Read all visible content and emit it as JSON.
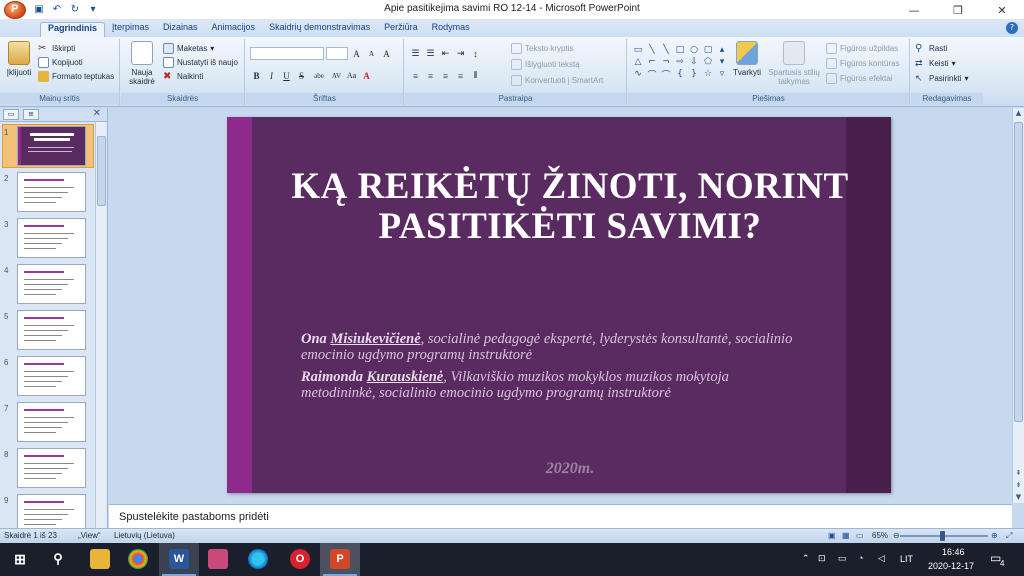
{
  "window": {
    "title": "Apie pasitikejima savimi RO 12-14 - Microsoft PowerPoint",
    "min_glyph": "—",
    "max_glyph": "❐",
    "close_glyph": "✕"
  },
  "tabs": [
    "Pagrindinis",
    "Įterpimas",
    "Dizainas",
    "Animacijos",
    "Skaidrių demonstravimas",
    "Peržiūra",
    "Rodymas"
  ],
  "ribbon": {
    "clipboard": {
      "paste": "Įklijuoti",
      "cut": "Iškirpti",
      "copy": "Kopijuoti",
      "format_painter": "Formato teptukas",
      "label": "Mainų sritis"
    },
    "slides": {
      "new_slide": "Nauja skaidrė",
      "layout": "Maketas",
      "reset": "Nustatyti iš naujo",
      "delete": "Naikinti",
      "label": "Skaidrės"
    },
    "font": {
      "label": "Šriftas",
      "bold": "B",
      "italic": "I",
      "underline": "U",
      "strike": "S",
      "shadow": "abe",
      "spacing": "AV",
      "case": "Aa",
      "grow": "A",
      "shrink": "A",
      "clear": "A"
    },
    "paragraph": {
      "label": "Pastraipa",
      "text_direction": "Teksto kryptis",
      "align_text": "Išlygiuoti tekstą",
      "smartart": "Konvertuoti į SmartArt"
    },
    "drawing": {
      "label": "Piešimas",
      "arrange": "Tvarkyti",
      "quick_styles": "Spartusis stilių taikymas",
      "shape_fill": "Figūros užpildas",
      "shape_outline": "Figūros kontūras",
      "shape_effects": "Figūros efektai"
    },
    "editing": {
      "label": "Redagavimas",
      "find": "Rasti",
      "replace": "Keisti",
      "select": "Pasirinkti"
    }
  },
  "thumbnails": {
    "numbers": [
      "1",
      "2",
      "3",
      "4",
      "5",
      "6",
      "7",
      "8",
      "9"
    ],
    "selected_index": 0
  },
  "slide": {
    "title": "KĄ REIKĖTŲ ŽINOTI, NORINT PASITIKĖTI SAVIMI?",
    "author1_first": "Ona",
    "author1_last": "Misiukevičienė",
    "author1_role": ", socialinė pedagogė ekspertė, lyderystės konsultantė, socialinio emocinio ugdymo programų instruktorė",
    "author2_first": "Raimonda",
    "author2_last": "Kurauskienė",
    "author2_role": ", Vilkaviškio muzikos mokyklos muzikos mokytoja metodininkė,  socialinio emocinio ugdymo programų instruktorė",
    "year": "2020m."
  },
  "notes": {
    "placeholder": "Spustelėkite pastaboms pridėti"
  },
  "status": {
    "slide_info": "Skaidrė 1 iš 23",
    "theme": "„View“",
    "language": "Lietuvių (Lietuva)",
    "zoom": "65%"
  },
  "taskbar": {
    "language": "LIT",
    "time": "16:46",
    "date": "2020-12-17",
    "notifications": "4"
  },
  "colors": {
    "slide_bg": "#5a2b60",
    "slide_accent_left": "#8e2a8c",
    "slide_accent_right": "#481f4d",
    "ribbon_bg": "#dbe7f5",
    "taskbar": "#1a1f2b"
  }
}
